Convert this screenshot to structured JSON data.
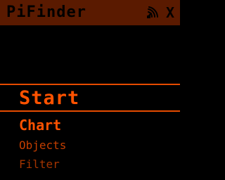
{
  "app": {
    "title": "PiFinder",
    "close_label": "X",
    "status_icon": "signal-icon"
  },
  "menu": {
    "items": [
      {
        "label": "Start",
        "selected": true
      },
      {
        "label": "Chart",
        "selected": false
      },
      {
        "label": "Objects",
        "selected": false
      },
      {
        "label": "Filter",
        "selected": false
      }
    ]
  },
  "colors": {
    "titlebar_bg": "#5a1a00",
    "accent": "#ff5200",
    "dim_text": "#c33e00",
    "background": "#000000"
  }
}
